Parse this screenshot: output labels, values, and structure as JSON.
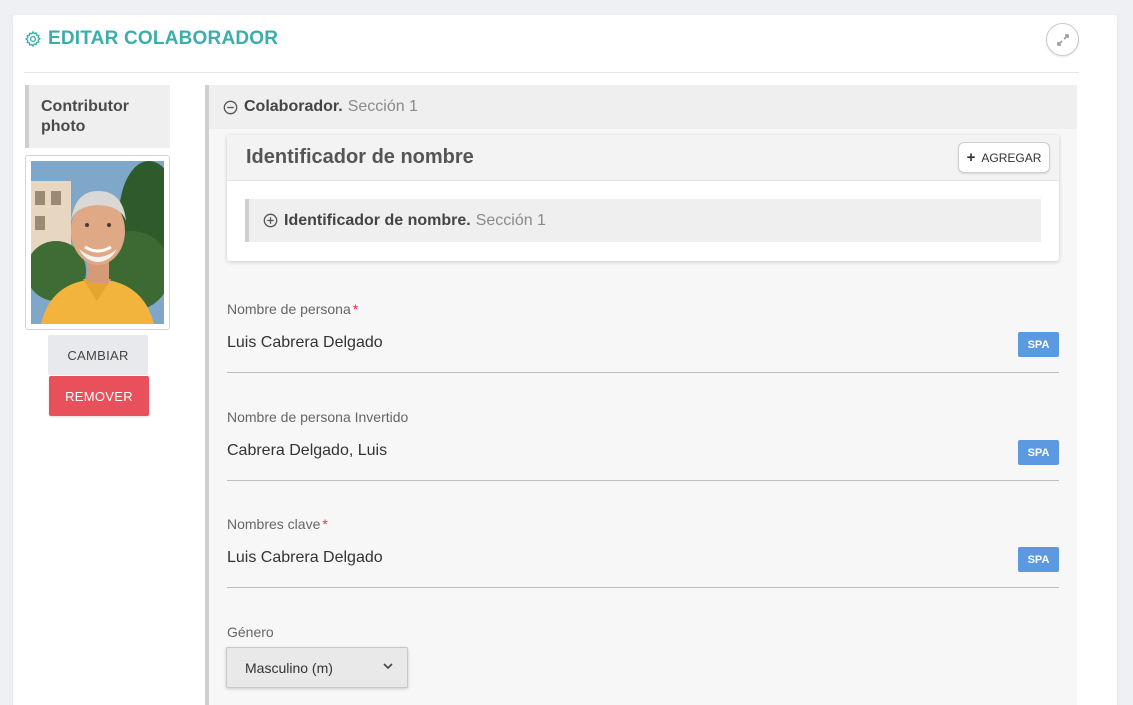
{
  "header": {
    "title": "EDITAR COLABORADOR",
    "title_color": "#3aaeaa"
  },
  "photo": {
    "label": "Contributor photo",
    "change_button": "CAMBIAR",
    "remove_button": "REMOVER"
  },
  "section": {
    "title": "Colaborador.",
    "subtitle": "Sección 1"
  },
  "identifier": {
    "title": "Identificador de nombre",
    "add_button": "AGREGAR",
    "item_title": "Identificador de nombre.",
    "item_subtitle": "Sección 1"
  },
  "fields": [
    {
      "label": "Nombre de persona",
      "required": "*",
      "value": "Luis Cabrera Delgado",
      "lang": "SPA"
    },
    {
      "label": "Nombre de persona Invertido",
      "required": "",
      "value": "Cabrera Delgado, Luis",
      "lang": "SPA"
    },
    {
      "label": "Nombres clave",
      "required": "*",
      "value": "Luis Cabrera Delgado",
      "lang": "SPA"
    }
  ],
  "gender": {
    "label": "Género",
    "selected": "Masculino (m)"
  },
  "colors": {
    "accent": "#3aaeaa",
    "danger": "#e8505b",
    "lang_badge": "#5b9ae0"
  }
}
